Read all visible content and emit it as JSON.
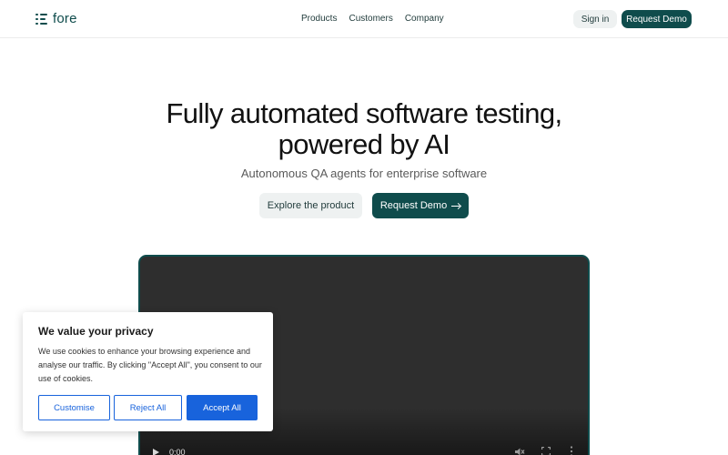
{
  "header": {
    "logo_text": "fore",
    "nav": [
      {
        "label": "Products"
      },
      {
        "label": "Customers"
      },
      {
        "label": "Company"
      }
    ],
    "signin_label": "Sign in",
    "demo_label": "Request Demo"
  },
  "hero": {
    "title_line1": "Fully automated software testing,",
    "title_line2": "powered by AI",
    "subtitle": "Autonomous QA agents for enterprise software",
    "explore_label": "Explore the product",
    "demo_label": "Request Demo"
  },
  "video": {
    "time": "0:00"
  },
  "cookie": {
    "title": "We value your privacy",
    "text": "We use cookies to enhance your browsing experience and analyse our traffic. By clicking \"Accept All\", you consent to our use of cookies.",
    "customise_label": "Customise",
    "reject_label": "Reject All",
    "accept_label": "Accept All"
  },
  "colors": {
    "brand": "#0f4c4c",
    "consent_blue": "#1863dc"
  },
  "icons": [
    "logo-mark-icon",
    "arrow-right-icon",
    "play-icon",
    "mute-icon",
    "fullscreen-icon",
    "more-vert-icon"
  ]
}
